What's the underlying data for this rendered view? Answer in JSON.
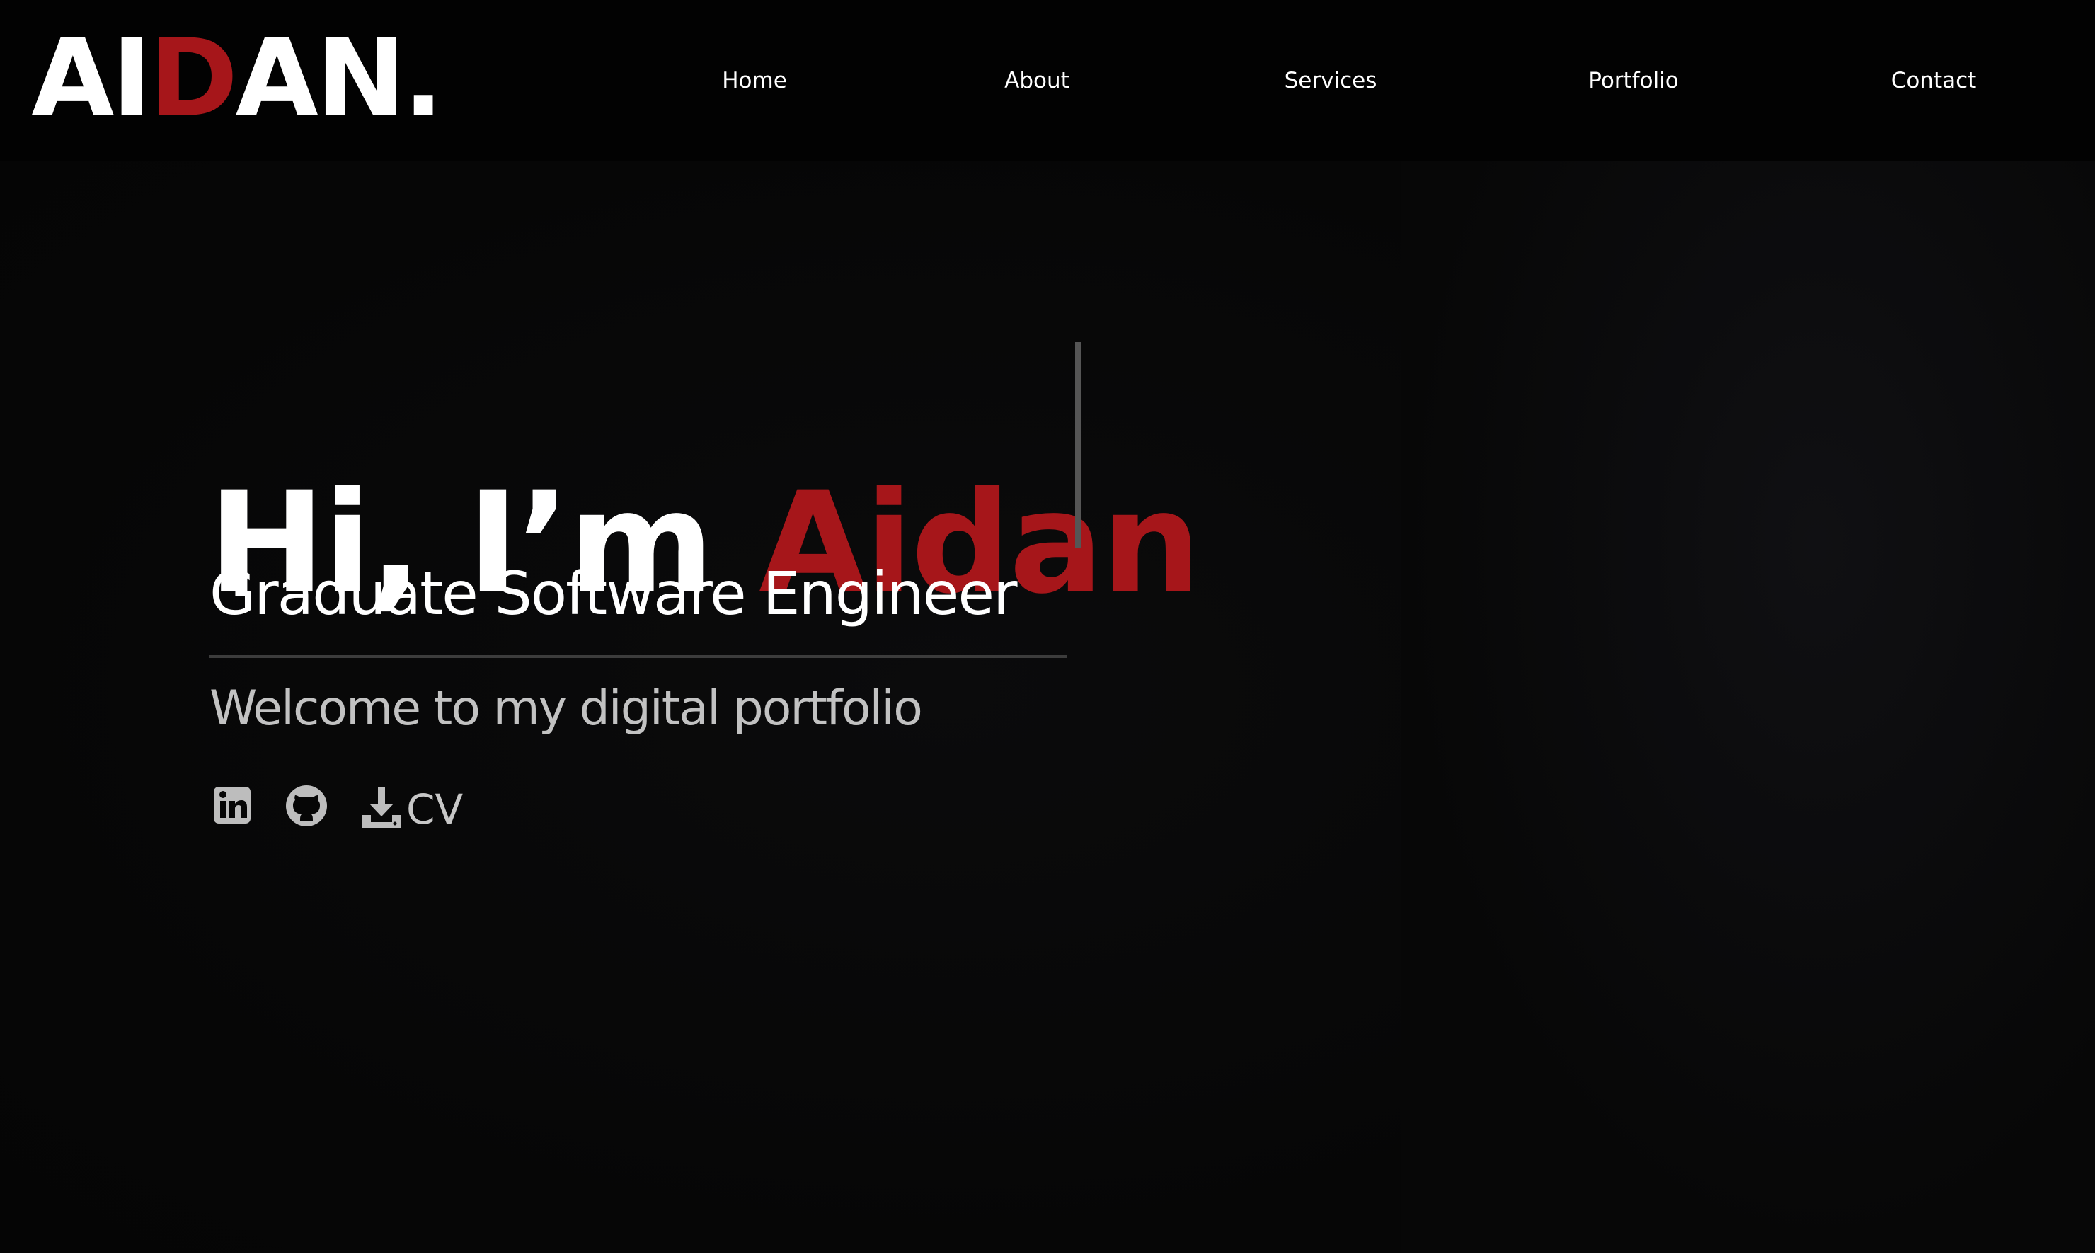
{
  "logo": {
    "part1": "AI",
    "part2": "D",
    "part3": "AN",
    "part4": "."
  },
  "nav": {
    "items": [
      {
        "label": "Home"
      },
      {
        "label": "About"
      },
      {
        "label": "Services"
      },
      {
        "label": "Portfolio"
      },
      {
        "label": "Contact"
      }
    ]
  },
  "hero": {
    "greeting": "Hi, I’m ",
    "name": "Aidan",
    "subtitle": "Graduate Software Engineer",
    "tagline": "Welcome to my digital portfolio"
  },
  "social": {
    "linkedin_icon": "linkedin-icon",
    "github_icon": "github-icon",
    "download_icon": "download-icon",
    "cv_label": "CV"
  },
  "photo": {
    "alt": "portrait-photo"
  },
  "colors": {
    "background": "#060606",
    "nav_background": "#020202",
    "accent_red": "#a6161a",
    "text": "#ffffff",
    "muted_text": "#c2c2c2",
    "icon_gray": "#bdbdbd"
  }
}
